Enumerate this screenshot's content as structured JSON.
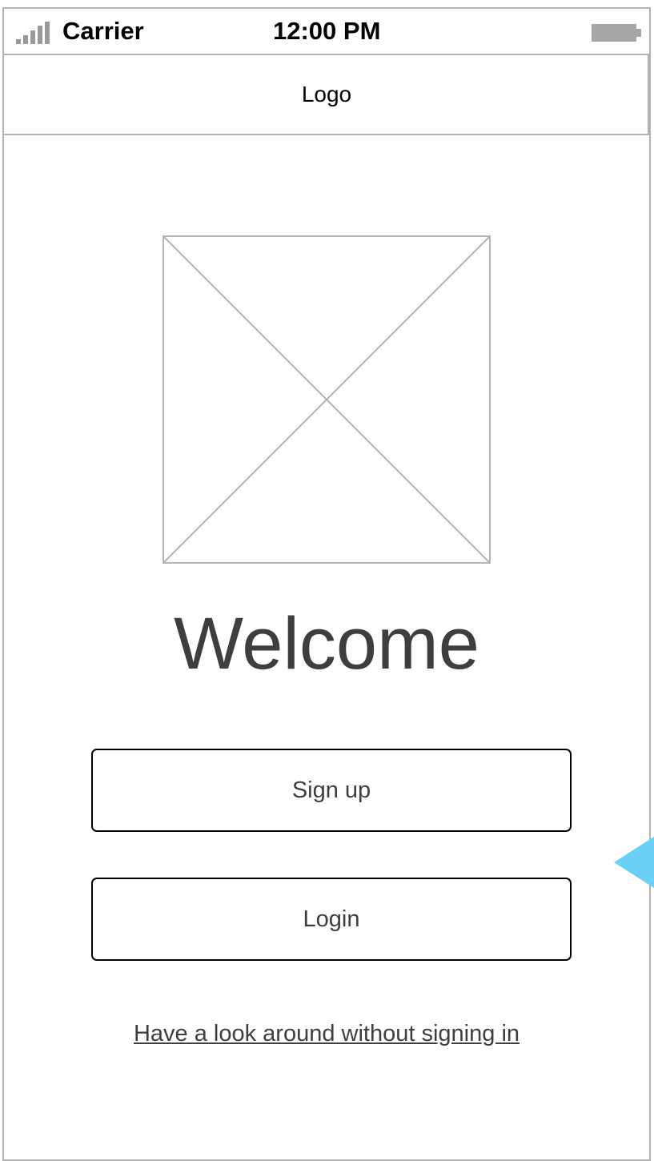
{
  "status_bar": {
    "carrier": "Carrier",
    "time": "12:00 PM",
    "signal_icon": "signal-bars-icon",
    "battery_icon": "battery-icon"
  },
  "header": {
    "logo_text": "Logo"
  },
  "hero": {
    "image_icon": "image-placeholder-icon"
  },
  "main": {
    "welcome_title": "Welcome",
    "signup_label": "Sign up",
    "login_label": "Login",
    "guest_link": "Have a look around without signing in"
  },
  "colors": {
    "frame_border": "#b3b3b3",
    "text_dark": "#3e3e3e",
    "marker": "#6ccff6"
  }
}
